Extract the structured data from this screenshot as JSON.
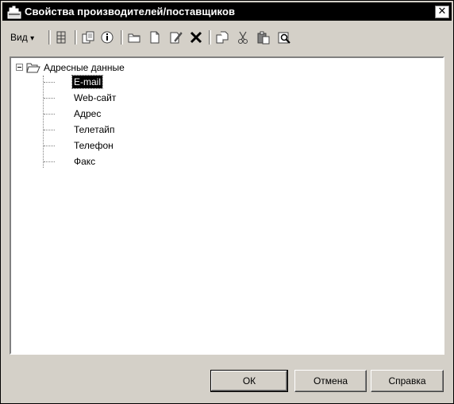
{
  "window": {
    "title": "Свойства производителей/поставщиков",
    "close_glyph": "✕"
  },
  "toolbar": {
    "view_label": "Вид",
    "view_arrow": "▾",
    "icons": [
      "columns-icon",
      "copy-icon",
      "info-icon",
      "folder-icon",
      "new-document-icon",
      "edit-icon",
      "delete-icon",
      "copy-properties-icon",
      "cut-icon",
      "paste-icon",
      "print-preview-icon"
    ]
  },
  "tree": {
    "root": {
      "label": "Адресные данные",
      "expanded": true
    },
    "items": [
      {
        "label": "E-mail",
        "selected": true
      },
      {
        "label": "Web-сайт"
      },
      {
        "label": "Адрес"
      },
      {
        "label": "Телетайп"
      },
      {
        "label": "Телефон"
      },
      {
        "label": "Факс"
      }
    ]
  },
  "buttons": {
    "ok": "ОК",
    "cancel": "Отмена",
    "help": "Справка"
  },
  "colors": {
    "face": "#d4d0c8",
    "titlebar": "#000000",
    "selection": "#000000"
  }
}
